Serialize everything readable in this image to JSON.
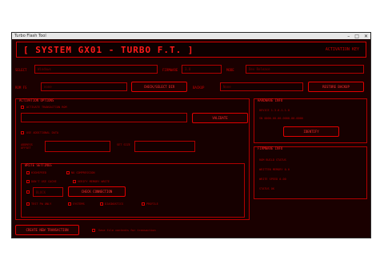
{
  "window": {
    "title": "Turbo Flash Tool",
    "controls": [
      "–",
      "□",
      "✕"
    ]
  },
  "banner": {
    "title": "[ SYSTEM GX01 - TURBO F.T. ]",
    "version": "ACTIVATION KEY"
  },
  "row1": {
    "select_label": "SELECT",
    "select_value": "Windows",
    "firmware_label": "FIRMWARE",
    "firmware_value": "3.0",
    "mode_label": "MODE",
    "mode_value": "Dev Release"
  },
  "row2": {
    "rom_label": "ROM FS",
    "rom_value": "none",
    "select_dir_label": "CHECK/SELECT DIR",
    "backup_label": "BACKUP",
    "backup_value": "None",
    "restore_label": "RESTORE BACKUP"
  },
  "left_panel": {
    "title": "ACTIVATION OPTIONS",
    "opt1": "ACTIVATE TRANSACTION ROM",
    "validate_label": "VALIDATE",
    "opt2": "USE ADDITIONAL DATA",
    "addr_label": "ADDRESS OFFSET",
    "size_label": "SET SIZE"
  },
  "write_panel": {
    "title": "WRITE SETTINGS",
    "opt_a": "HIGHSPEED",
    "opt_b": "NO COMPRESSION",
    "opt_c": "DON'T USE CACHE",
    "opt_d": "VERIFY MEMORY WRITE",
    "block_value": "BLOCK",
    "check_label": "CHECK CONNECTION",
    "opt_e": "TEST FW ONLY",
    "opt_f": "SYSTEMS",
    "opt_g": "DIAGNOSTICS",
    "opt_h": "PROFILE"
  },
  "right_top": {
    "title": "HARDWARE INFO",
    "line1": "DEVICE  1.3.0.1.1.0",
    "line2": "SN 0000-00-00-0000-00-0000",
    "button": "IDENTIFY"
  },
  "right_bottom": {
    "title": "FIRMWARE INFO",
    "line1": "ROM BUILD STATUS",
    "line2": "WRITTEN MEMORY 0.0",
    "line3": "WRITE SPEED 0.00",
    "line4": "STATUS OK"
  },
  "footer": {
    "button": "CREATE NEW TRANSACTION",
    "checkbox_label": "Save file contents for transaction"
  }
}
